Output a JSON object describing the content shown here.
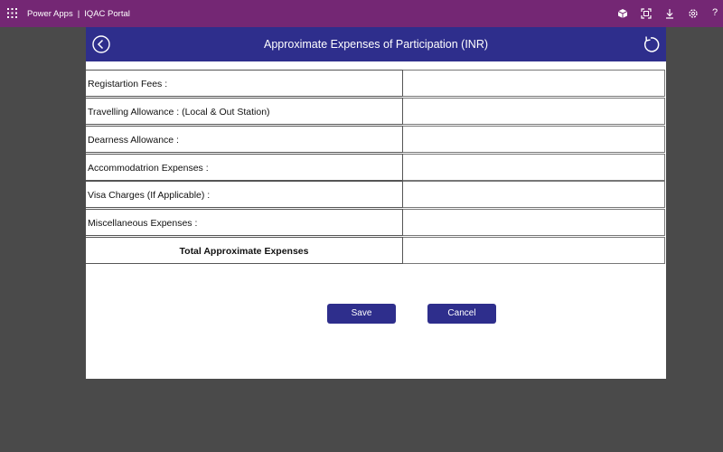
{
  "topbar": {
    "app_name": "Power Apps",
    "separator": "|",
    "portal_name": "IQAC Portal",
    "icons": [
      "waffle-icon",
      "cube-icon",
      "fit-screen-icon",
      "download-icon",
      "gear-icon",
      "help-icon"
    ],
    "help_glyph": "?"
  },
  "header": {
    "title": "Approximate Expenses of Participation (INR)",
    "back_icon": "back-arrow-icon",
    "reset_icon": "reset-icon"
  },
  "form": {
    "rows": [
      {
        "label": "Registartion Fees :",
        "value": ""
      },
      {
        "label": "Travelling Allowance : (Local & Out Station)",
        "value": ""
      },
      {
        "label": "Dearness Allowance :",
        "value": ""
      },
      {
        "label": "Accommodatrion Expenses :",
        "value": ""
      },
      {
        "label": "Visa Charges (If Applicable) :",
        "value": ""
      },
      {
        "label": "Miscellaneous Expenses :",
        "value": ""
      }
    ],
    "total_label": "Total Approximate Expenses",
    "total_value": ""
  },
  "buttons": {
    "save": "Save",
    "cancel": "Cancel"
  },
  "colors": {
    "topbar": "#742774",
    "header": "#2e2e8c",
    "button": "#2e2e8c",
    "background": "#4a4a4a"
  }
}
